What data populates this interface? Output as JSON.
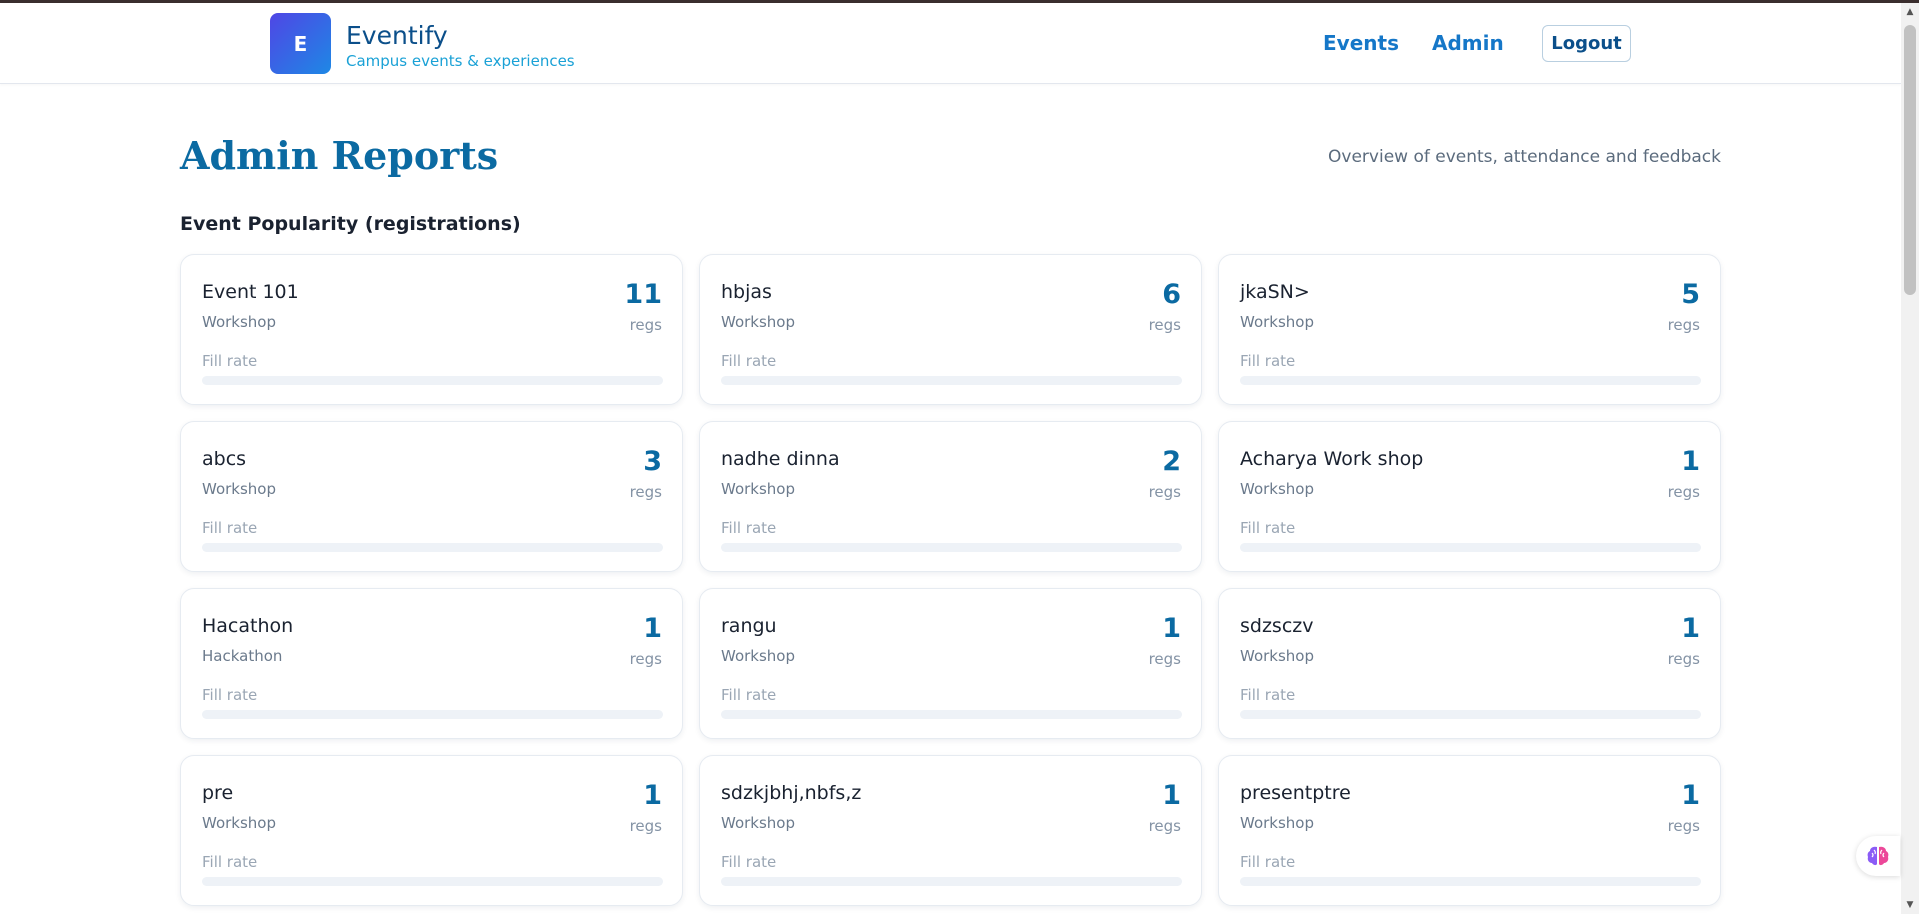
{
  "app": {
    "logo_letter": "E",
    "name": "Eventify",
    "tagline": "Campus events & experiences"
  },
  "nav": {
    "events_label": "Events",
    "admin_label": "Admin",
    "logout_label": "Logout"
  },
  "page": {
    "title": "Admin Reports",
    "subtitle": "Overview of events, attendance and feedback",
    "section_title": "Event Popularity (registrations)"
  },
  "cards": [
    {
      "name": "Event 101",
      "type": "Workshop",
      "count": "11",
      "unit": "regs",
      "fill_label": "Fill rate",
      "fill_fraction": 0
    },
    {
      "name": "hbjas",
      "type": "Workshop",
      "count": "6",
      "unit": "regs",
      "fill_label": "Fill rate",
      "fill_fraction": 0
    },
    {
      "name": "jkaSN>",
      "type": "Workshop",
      "count": "5",
      "unit": "regs",
      "fill_label": "Fill rate",
      "fill_fraction": 0
    },
    {
      "name": "abcs",
      "type": "Workshop",
      "count": "3",
      "unit": "regs",
      "fill_label": "Fill rate",
      "fill_fraction": 0
    },
    {
      "name": "nadhe dinna",
      "type": "Workshop",
      "count": "2",
      "unit": "regs",
      "fill_label": "Fill rate",
      "fill_fraction": 0
    },
    {
      "name": "Acharya Work shop",
      "type": "Workshop",
      "count": "1",
      "unit": "regs",
      "fill_label": "Fill rate",
      "fill_fraction": 0
    },
    {
      "name": "Hacathon",
      "type": "Hackathon",
      "count": "1",
      "unit": "regs",
      "fill_label": "Fill rate",
      "fill_fraction": 0
    },
    {
      "name": "rangu",
      "type": "Workshop",
      "count": "1",
      "unit": "regs",
      "fill_label": "Fill rate",
      "fill_fraction": 0
    },
    {
      "name": "sdzsczv",
      "type": "Workshop",
      "count": "1",
      "unit": "regs",
      "fill_label": "Fill rate",
      "fill_fraction": 0
    },
    {
      "name": "pre",
      "type": "Workshop",
      "count": "1",
      "unit": "regs",
      "fill_label": "Fill rate",
      "fill_fraction": 0
    },
    {
      "name": "sdzkjbhj,nbfs,z",
      "type": "Workshop",
      "count": "1",
      "unit": "regs",
      "fill_label": "Fill rate",
      "fill_fraction": 0
    },
    {
      "name": "presentptre",
      "type": "Workshop",
      "count": "1",
      "unit": "regs",
      "fill_label": "Fill rate",
      "fill_fraction": 0
    }
  ],
  "colors": {
    "brand": "#0b6aa2",
    "accent": "#1577c8",
    "logo_gradient_start": "#4f46e5",
    "logo_gradient_end": "#1e88e5"
  },
  "icons": {
    "assistant": "brain-icon",
    "scroll_up": "triangle-up-icon",
    "scroll_down": "triangle-down-icon"
  }
}
